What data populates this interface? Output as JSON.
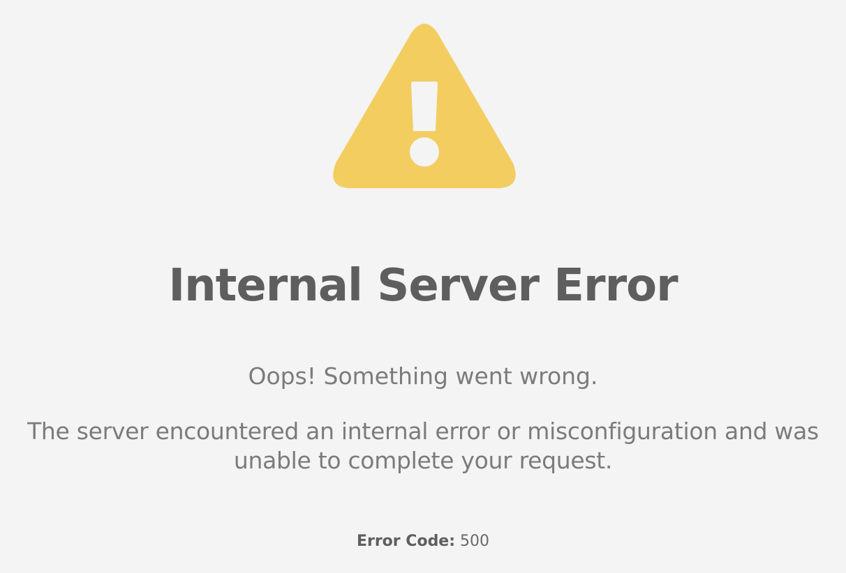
{
  "icon": {
    "name": "warning-triangle-icon",
    "color": "#f3cd60"
  },
  "title": "Internal Server Error",
  "subtitle": "Oops! Something went wrong.",
  "description": "The server encountered an internal error or misconfiguration and was unable to complete your request.",
  "error_code": {
    "label": "Error Code:",
    "value": "500"
  }
}
